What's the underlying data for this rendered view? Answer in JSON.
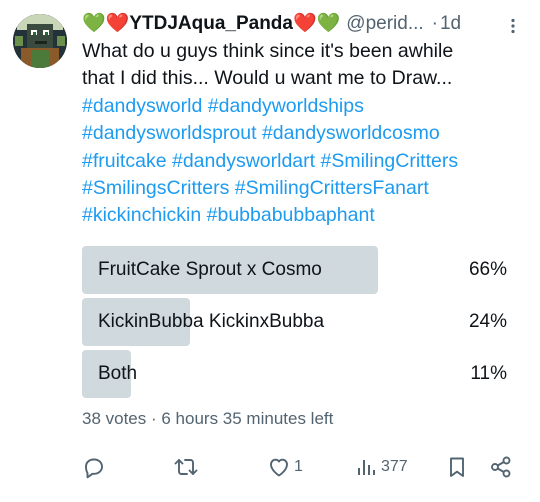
{
  "header": {
    "display_name": "💚❤️YTDJAqua_Panda❤️💚",
    "handle": "@perid...",
    "separator": "·",
    "time": "1d"
  },
  "tweet": {
    "text_line1": "What do u guys think since it's been awhile",
    "text_line2": "that I did this... Would u want me to Draw...",
    "hashtags": [
      "#dandysworld",
      "#dandyworldships",
      "#dandysworldsprout",
      "#dandysworldcosmo",
      "#fruitcake",
      "#dandysworldart",
      "#SmilingCritters",
      "#SmilingsCritters",
      "#SmilingCrittersFanart",
      "#kickinchickin",
      "#bubbabubbaphant"
    ]
  },
  "poll": {
    "options": [
      {
        "label": "FruitCake Sprout x Cosmo",
        "percent_text": "66%",
        "percent": 66
      },
      {
        "label": "KickinBubba KickinxBubba",
        "percent_text": "24%",
        "percent": 24
      },
      {
        "label": "Both",
        "percent_text": "11%",
        "percent": 11
      }
    ],
    "meta": "38 votes · 6 hours 35 minutes left"
  },
  "actions": {
    "reply_icon": "reply-icon",
    "retweet_icon": "retweet-icon",
    "like_icon": "heart-icon",
    "like_count": "1",
    "views_icon": "views-chart-icon",
    "views_count": "377",
    "bookmark_icon": "bookmark-icon",
    "share_icon": "share-icon"
  },
  "colors": {
    "link": "#1d9bf0",
    "muted": "#536471",
    "poll_bar": "#cfd9de",
    "text": "#0f1419"
  }
}
